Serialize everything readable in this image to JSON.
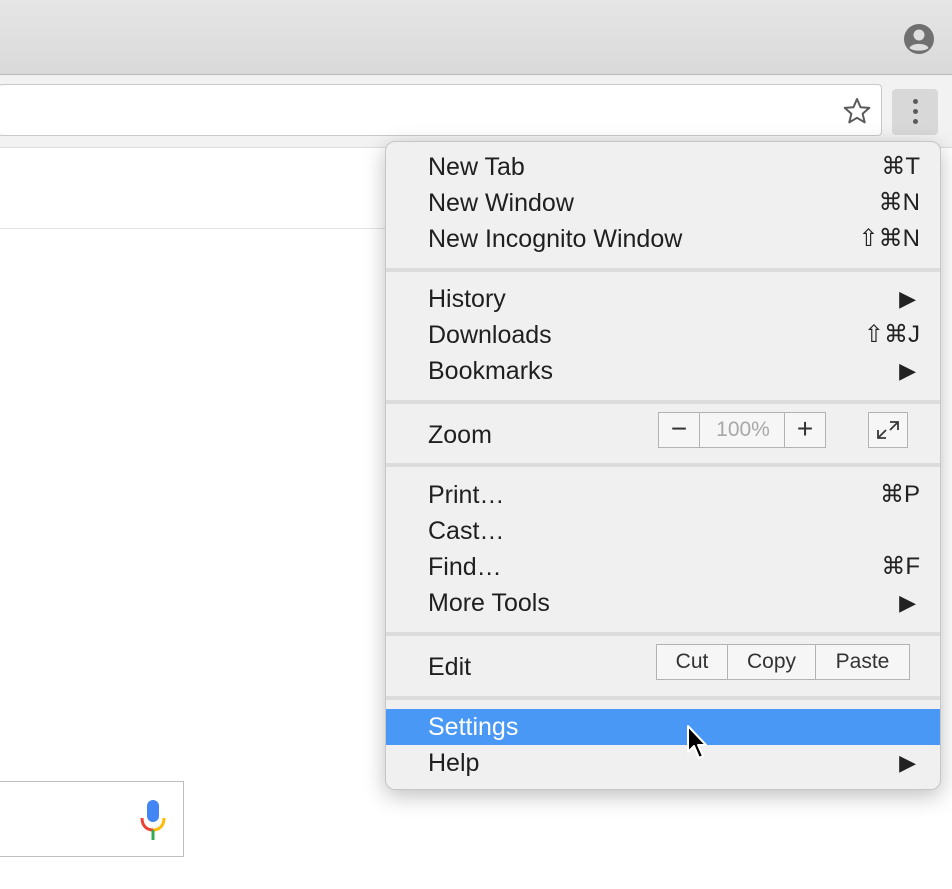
{
  "menu": {
    "items": {
      "new_tab": {
        "label": "New Tab",
        "shortcut": "⌘T"
      },
      "new_window": {
        "label": "New Window",
        "shortcut": "⌘N"
      },
      "new_incognito": {
        "label": "New Incognito Window",
        "shortcut": "⇧⌘N"
      },
      "history": {
        "label": "History",
        "arrow": "▶"
      },
      "downloads": {
        "label": "Downloads",
        "shortcut": "⇧⌘J"
      },
      "bookmarks": {
        "label": "Bookmarks",
        "arrow": "▶"
      },
      "zoom": {
        "label": "Zoom",
        "minus": "−",
        "value": "100%",
        "plus": "+"
      },
      "print": {
        "label": "Print…",
        "shortcut": "⌘P"
      },
      "cast": {
        "label": "Cast…"
      },
      "find": {
        "label": "Find…",
        "shortcut": "⌘F"
      },
      "more_tools": {
        "label": "More Tools",
        "arrow": "▶"
      },
      "edit": {
        "label": "Edit",
        "cut": "Cut",
        "copy": "Copy",
        "paste": "Paste"
      },
      "settings": {
        "label": "Settings"
      },
      "help": {
        "label": "Help",
        "arrow": "▶"
      }
    },
    "highlighted": "settings",
    "highlight_color": "#4a98f5"
  },
  "icons": {
    "profile": "profile-icon",
    "bookmark_star": "star-icon",
    "menu": "three-dot-menu-icon",
    "fullscreen": "fullscreen-icon",
    "microphone": "microphone-icon",
    "cursor": "mouse-pointer-icon"
  }
}
